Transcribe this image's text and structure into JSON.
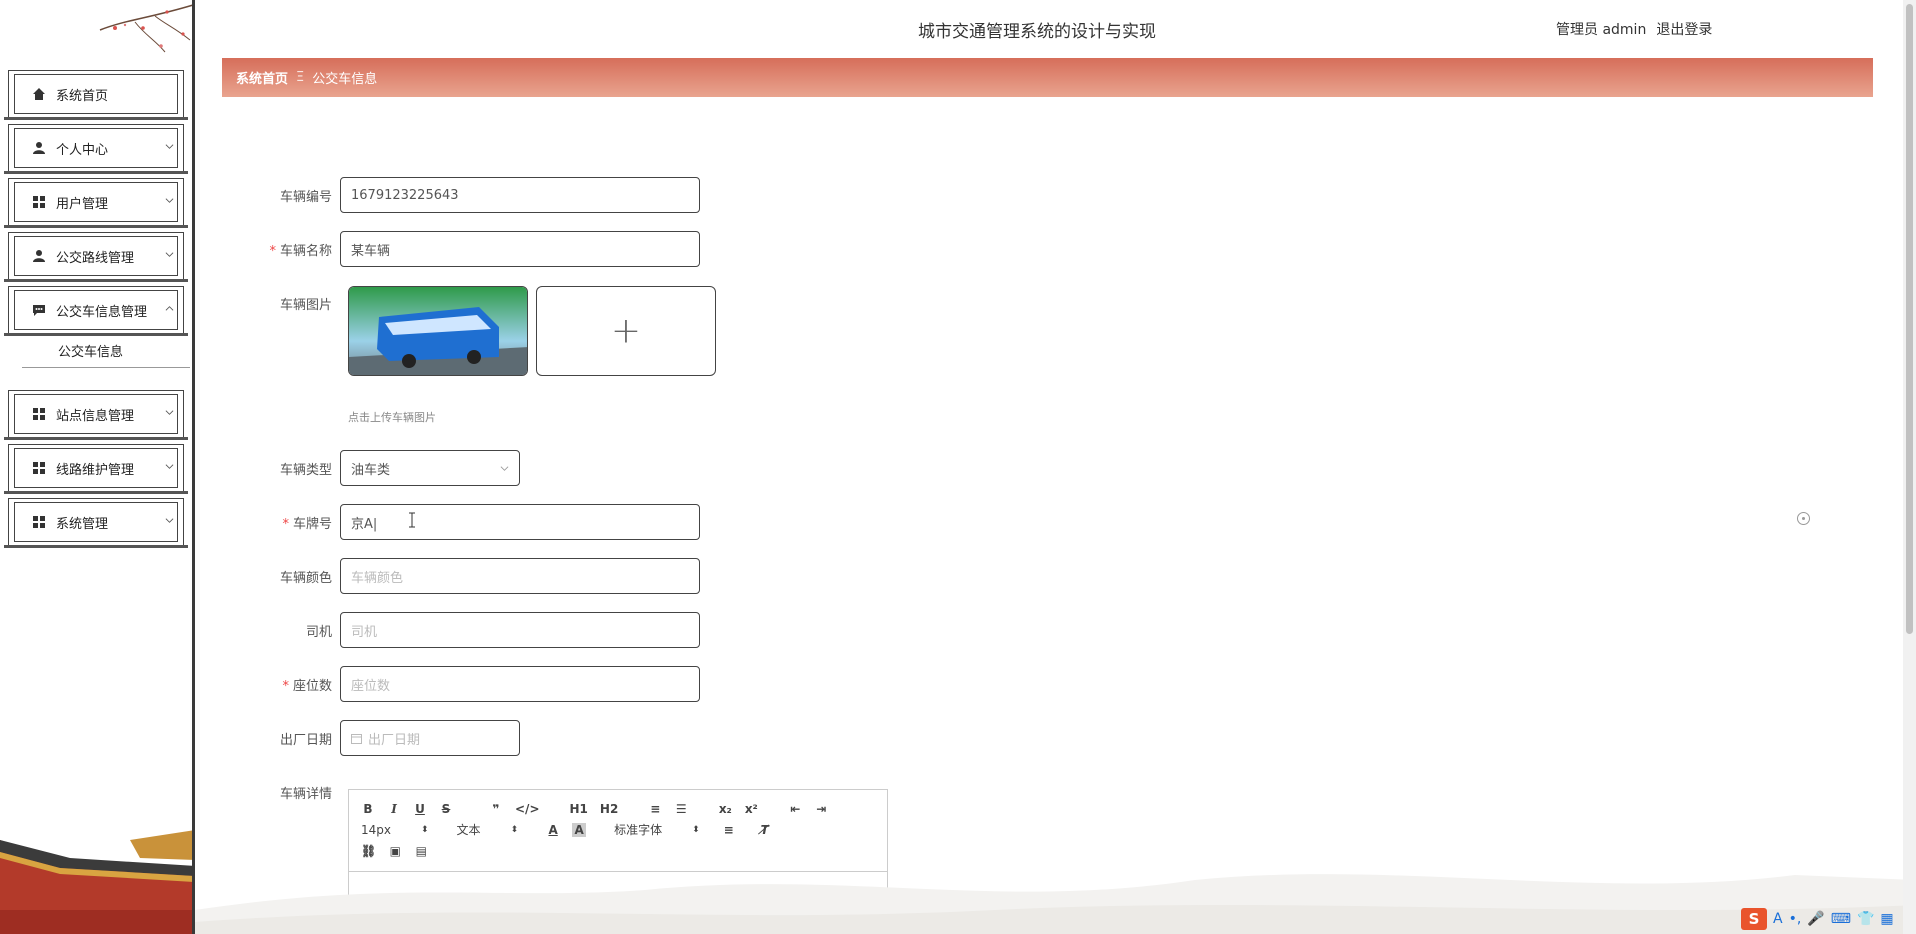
{
  "header": {
    "title": "城市交通管理系统的设计与实现",
    "user_label": "管理员 admin",
    "logout_label": "退出登录"
  },
  "breadcrumb": {
    "home": "系统首页",
    "separator": "Ξ",
    "current": "公交车信息"
  },
  "sidebar": {
    "items": [
      {
        "label": "系统首页",
        "icon": "home-icon"
      },
      {
        "label": "个人中心",
        "icon": "user-icon"
      },
      {
        "label": "用户管理",
        "icon": "grid-icon"
      },
      {
        "label": "公交路线管理",
        "icon": "user-icon"
      },
      {
        "label": "公交车信息管理",
        "icon": "chat-icon"
      },
      {
        "label": "站点信息管理",
        "icon": "grid-icon"
      },
      {
        "label": "线路维护管理",
        "icon": "grid-icon"
      },
      {
        "label": "系统管理",
        "icon": "grid-icon"
      }
    ],
    "submenu_label": "公交车信息"
  },
  "form": {
    "vehicle_no": {
      "label": "车辆编号",
      "value": "1679123225643"
    },
    "vehicle_name": {
      "label": "车辆名称",
      "value": "某车辆"
    },
    "vehicle_image": {
      "label": "车辆图片",
      "hint": "点击上传车辆图片"
    },
    "vehicle_type": {
      "label": "车辆类型",
      "value": "油车类"
    },
    "plate_no": {
      "label": "车牌号",
      "value": "京A|"
    },
    "vehicle_color": {
      "label": "车辆颜色",
      "placeholder": "车辆颜色"
    },
    "driver": {
      "label": "司机",
      "placeholder": "司机"
    },
    "seats": {
      "label": "座位数",
      "placeholder": "座位数"
    },
    "manufacture_date": {
      "label": "出厂日期",
      "placeholder": "出厂日期"
    },
    "details": {
      "label": "车辆详情"
    }
  },
  "editor": {
    "font_size": "14px",
    "text_format": "文本",
    "font_family": "标准字体",
    "h1": "H1",
    "h2": "H2"
  },
  "colors": {
    "breadcrumb_start": "#d66e5a",
    "breadcrumb_end": "#e9a48f",
    "required": "#e44444"
  }
}
